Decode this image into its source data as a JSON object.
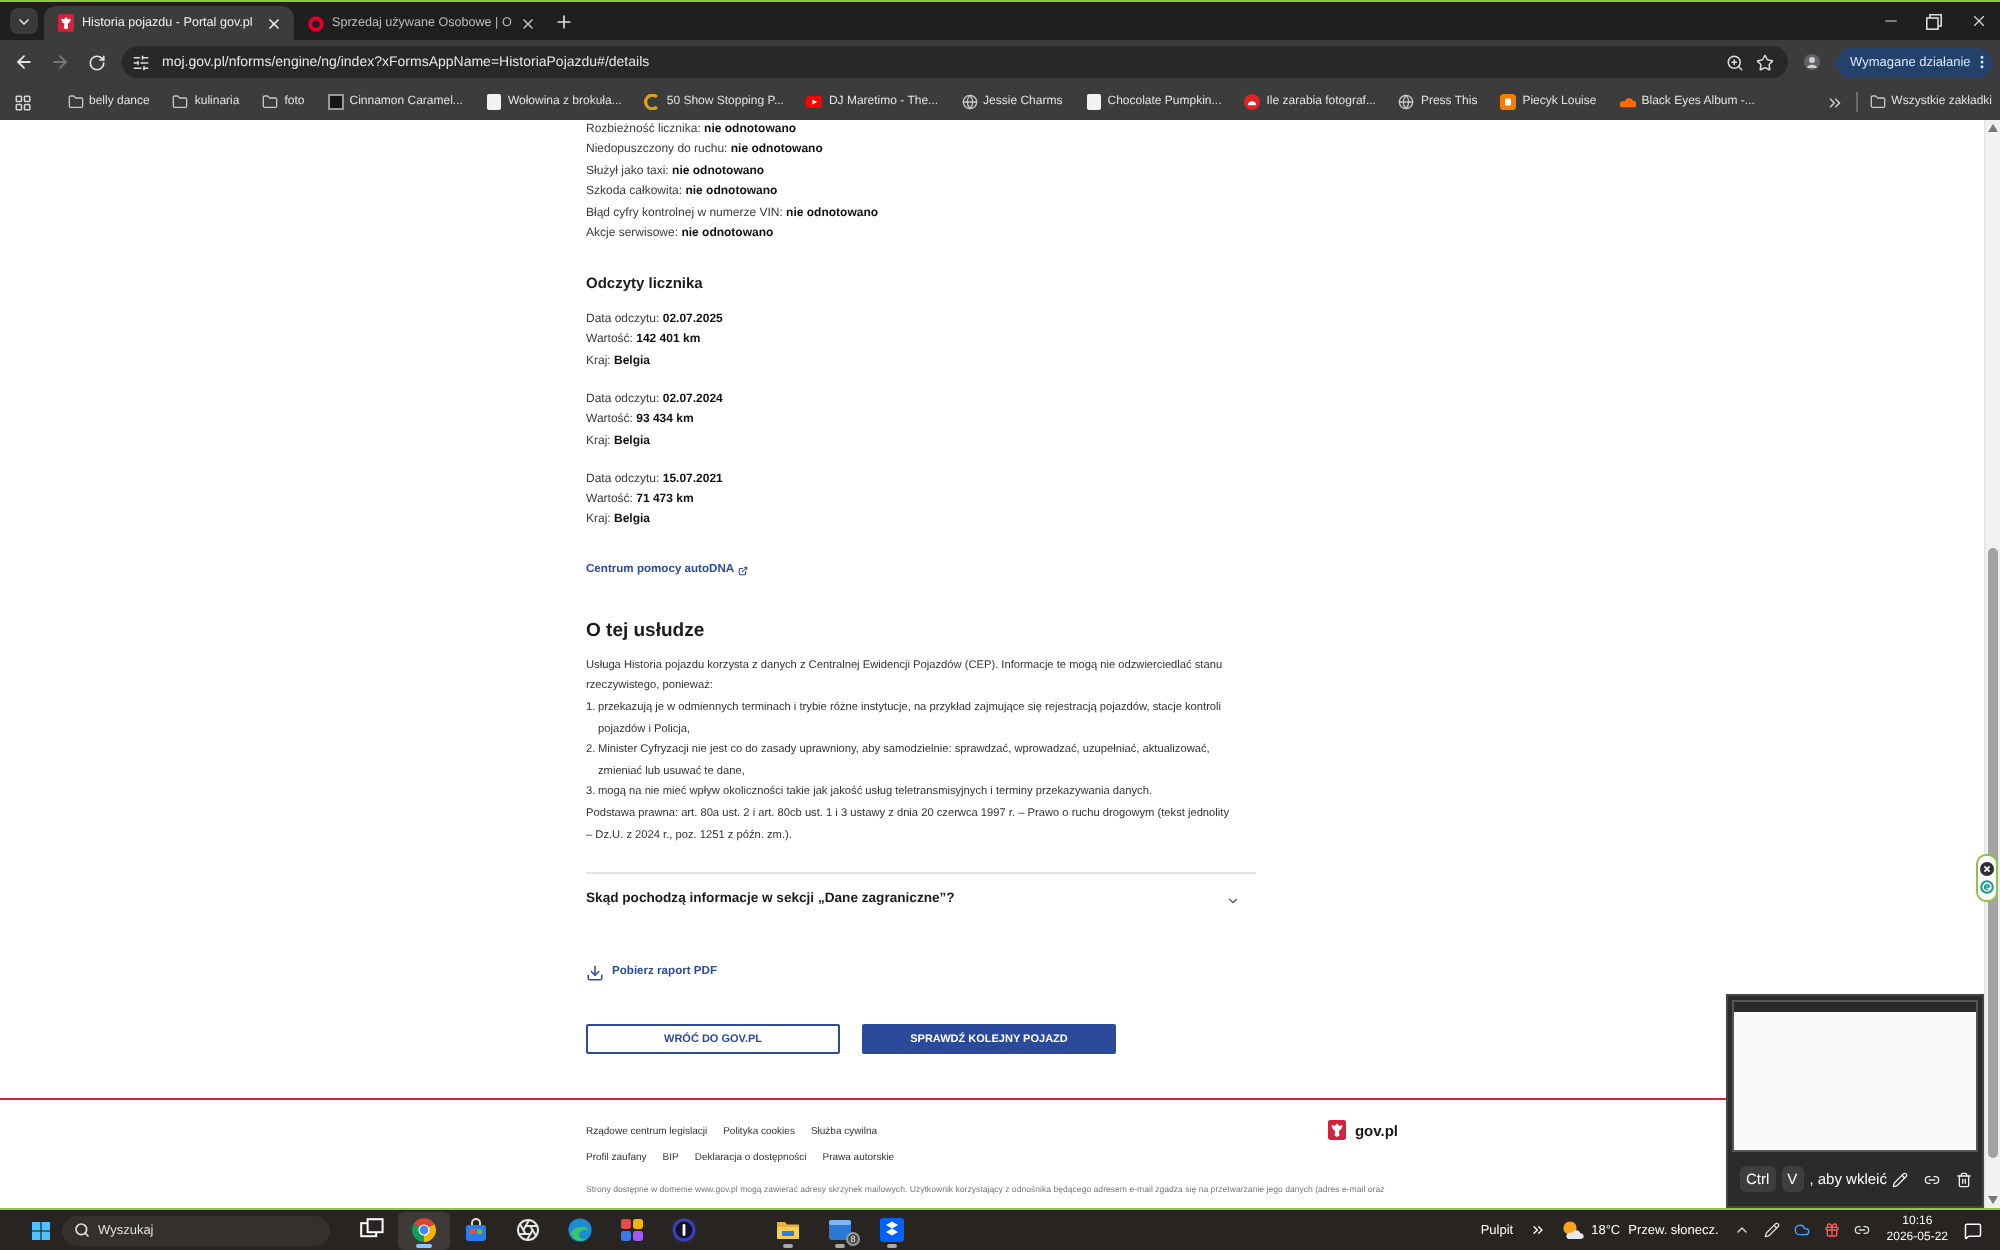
{
  "browser": {
    "tabs": [
      {
        "title": "Historia pojazdu - Portal gov.pl",
        "selected": true
      },
      {
        "title": "Sprzedaj używane Osobowe | O",
        "selected": false
      }
    ],
    "forward_disabled": true,
    "url": "moj.gov.pl/nforms/engine/ng/index?xFormsAppName=HistoriaPojazdu#/details",
    "action_button": "Wymagane działanie",
    "bookmarks": [
      {
        "kind": "folder",
        "label": "belly dance"
      },
      {
        "kind": "folder",
        "label": "kulinaria"
      },
      {
        "kind": "folder",
        "label": "foto"
      },
      {
        "kind": "link",
        "label": "Cinnamon Caramel..."
      },
      {
        "kind": "link",
        "label": "Wołowina z brokuła..."
      },
      {
        "kind": "link",
        "label": "50 Show Stopping P..."
      },
      {
        "kind": "link",
        "label": "DJ Maretimo - The..."
      },
      {
        "kind": "link",
        "label": "Jessie Charms"
      },
      {
        "kind": "link",
        "label": "Chocolate Pumpkin..."
      },
      {
        "kind": "link",
        "label": "Ile zarabia fotograf..."
      },
      {
        "kind": "link",
        "label": "Press This"
      },
      {
        "kind": "link",
        "label": "Piecyk Louise"
      },
      {
        "kind": "link",
        "label": "Black Eyes Album -..."
      }
    ],
    "all_bookmarks": "Wszystkie zakładki"
  },
  "page": {
    "details": [
      {
        "label": "Rozbieżność licznika:",
        "value": "nie odnotowano"
      },
      {
        "label": "Niedopuszczony do ruchu:",
        "value": "nie odnotowano"
      },
      {
        "label": "Służył jako taxi:",
        "value": "nie odnotowano"
      },
      {
        "label": "Szkoda całkowita:",
        "value": "nie odnotowano"
      },
      {
        "label": "Błąd cyfry kontrolnej w numerze VIN:",
        "value": "nie odnotowano"
      },
      {
        "label": "Akcje serwisowe:",
        "value": "nie odnotowano"
      }
    ],
    "readings_title": "Odczyty licznika",
    "readings": [
      {
        "lines": [
          {
            "label": "Data odczytu:",
            "value": "02.07.2025"
          },
          {
            "label": "Wartość:",
            "value": "142 401 km"
          },
          {
            "label": "Kraj:",
            "value": "Belgia"
          }
        ]
      },
      {
        "lines": [
          {
            "label": "Data odczytu:",
            "value": "02.07.2024"
          },
          {
            "label": "Wartość:",
            "value": "93 434 km"
          },
          {
            "label": "Kraj:",
            "value": "Belgia"
          }
        ]
      },
      {
        "lines": [
          {
            "label": "Data odczytu:",
            "value": "15.07.2021"
          },
          {
            "label": "Wartość:",
            "value": "71 473 km"
          },
          {
            "label": "Kraj:",
            "value": "Belgia"
          }
        ]
      }
    ],
    "help_link": "Centrum pomocy autoDNA",
    "about": {
      "title": "O tej usłudze",
      "intro": "Usługa Historia pojazdu korzysta z danych z Centralnej Ewidencji Pojazdów (CEP). Informacje te mogą nie odzwierciedlać stanu rzeczywistego, ponieważ:",
      "items": [
        {
          "number": "1.",
          "text": "przekazują je w odmiennych terminach i trybie różne instytucje, na przykład zajmujące się rejestracją pojazdów, stacje kontroli pojazdów i Policja,"
        },
        {
          "number": "2.",
          "text": "Minister Cyfryzacji nie jest co do zasady uprawniony, aby samodzielnie: sprawdzać, wprowadzać, uzupełniać, aktualizować, zmieniać lub usuwać te dane,"
        },
        {
          "number": "3.",
          "text": "mogą na nie mieć wpływ okoliczności takie jak jakość usług teletransmisyjnych i terminy przekazywania danych."
        }
      ],
      "legal": "Podstawa prawna: art. 80a ust. 2 i art. 80cb ust. 1 i 3 ustawy z dnia 20 czerwca 1997 r. – Prawo o ruchu drogowym (tekst jednolity – Dz.U. z 2024 r., poz. 1251 z późn. zm.)."
    },
    "accordion": {
      "title": "Skąd pochodzą informacje w sekcji „Dane zagraniczne”?",
      "expanded": false
    },
    "pdf_link": "Pobierz raport PDF",
    "buttons": [
      {
        "label": "WRÓĆ DO GOV.PL",
        "kind": "secondary"
      },
      {
        "label": "SPRAWDŹ KOLEJNY POJAZD",
        "kind": "primary"
      }
    ]
  },
  "footer": {
    "rows": [
      {
        "links": [
          "Rządowe centrum legislacji",
          "Polityka cookies",
          "Służba cywilna"
        ]
      },
      {
        "links": [
          "Profil zaufany",
          "BIP",
          "Deklaracja o dostępności",
          "Prawa autorskie"
        ]
      }
    ],
    "logo_text": "gov.pl",
    "notice": "Strony dostępne w domenie www.gov.pl mogą zawierać adresy skrzynek mailowych. Użytkownik korzystający z odnośnika będącego adresem e-mail zgadza się na przetwarzanie jego danych (adres e-mail oraz"
  },
  "clipboard_popup": {
    "keys": [
      "Ctrl",
      "V"
    ],
    "hint": ", aby wkleić"
  },
  "taskbar": {
    "search": {
      "placeholder": "Wyszukaj"
    },
    "apps": [
      {
        "selected": false,
        "running": false
      },
      {
        "selected": true,
        "running": true
      },
      {
        "selected": false,
        "running": false
      },
      {
        "selected": false,
        "running": false
      },
      {
        "selected": false,
        "running": false
      },
      {
        "selected": false,
        "running": false
      },
      {
        "selected": false,
        "running": false
      },
      {
        "selected": false,
        "running": true
      },
      {
        "selected": false,
        "running": true,
        "badge": "8"
      },
      {
        "selected": false,
        "running": true
      }
    ],
    "desktop": "Pulpit",
    "weather": {
      "temperature": "18°C",
      "condition": "Przew. słonecz."
    },
    "time": "10:16",
    "date": "2026-05-22"
  }
}
